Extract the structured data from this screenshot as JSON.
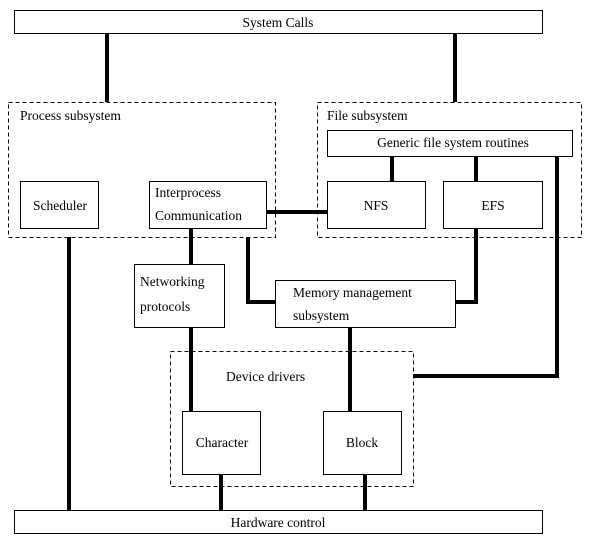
{
  "diagram": {
    "system_calls": "System Calls",
    "process_subsystem": "Process subsystem",
    "file_subsystem": "File subsystem",
    "generic_fs": "Generic file system routines",
    "scheduler": "Scheduler",
    "ipc_line1": "Interprocess",
    "ipc_line2": "Communication",
    "nfs": "NFS",
    "efs": "EFS",
    "networking_line1": "Networking",
    "networking_line2": "protocols",
    "memory_line1": "Memory management",
    "memory_line2": "subsystem",
    "device_drivers": "Device drivers",
    "character": "Character",
    "block": "Block",
    "hardware_control": "Hardware control"
  }
}
